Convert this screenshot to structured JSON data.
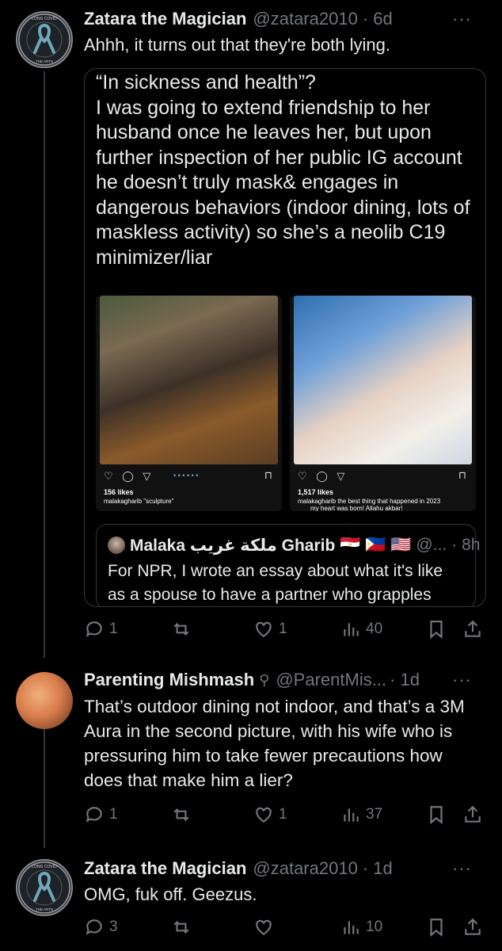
{
  "tweets": [
    {
      "name": "Zatara the Magician",
      "handle": "@zatara2010",
      "time": "· 6d",
      "more": "···",
      "text": "Ahhh, it turns out that they're both lying.",
      "avatar_icon": "awareness-ribbon-icon",
      "avatar_ring_text": "LONG COVID AWARENESS · PROTECT THE HEART OF THE ARTS",
      "quote": {
        "text": "“In sickness and health”?\nI was going to extend friendship to her husband once he leaves her, but upon further inspection of her public IG account he doesn’t truly mask& engages in dangerous behaviors (indoor dining, lots of maskless activity) so she’s a neolib C19 minimizer/liar",
        "images": [
          {
            "likes": "156 likes",
            "caption": "malakagharib \"sculpture\""
          },
          {
            "likes": "1,517 likes",
            "caption": "malakagharib the best thing that happened in 2023",
            "caption2": "my heart was born! Allahu akbar!"
          }
        ],
        "nested": {
          "name": "Malaka ملكة غريب Gharib",
          "flags": "🇪🇬 🇵🇭 🇺🇸",
          "handle": "@...",
          "time": "· 8h",
          "text": "For NPR, I wrote an essay about what it's like as a spouse to have a partner who grapples"
        }
      },
      "stats": {
        "replies": "1",
        "retweets": "",
        "likes": "1",
        "views": "40"
      }
    },
    {
      "name": "Parenting Mishmash",
      "handle": "@ParentMis...",
      "time": "· 1d",
      "more": "···",
      "text": "That’s outdoor dining not indoor, and that’s a 3M Aura in the second picture, with his wife who is pressuring him to take fewer precautions how does that make him a lier?",
      "stats": {
        "replies": "1",
        "retweets": "",
        "likes": "1",
        "views": "37"
      }
    },
    {
      "name": "Zatara the Magician",
      "handle": "@zatara2010",
      "time": "· 1d",
      "more": "···",
      "text": "OMG, fuk off. Geezus.",
      "stats": {
        "replies": "3",
        "retweets": "",
        "likes": "",
        "views": "10"
      }
    }
  ],
  "colors": {
    "background": "#000000",
    "text": "#e7e9ea",
    "muted": "#71767b",
    "border": "#333639"
  }
}
